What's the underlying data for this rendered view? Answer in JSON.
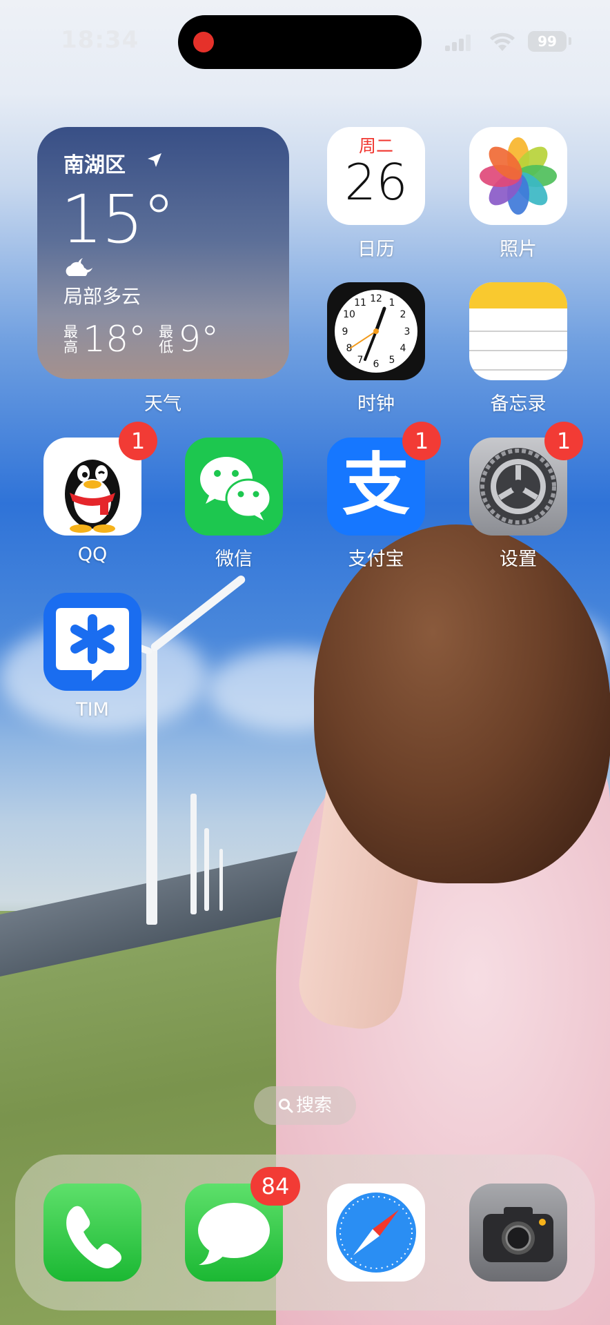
{
  "status_bar": {
    "time": "18:34",
    "battery": "99"
  },
  "weather_widget": {
    "location": "南湖区",
    "temperature": "15°",
    "condition": "局部多云",
    "high_label": "最高",
    "high_value": "18°",
    "low_label": "最低",
    "low_value": "9°",
    "app_label": "天气"
  },
  "apps": {
    "calendar": {
      "label": "日历",
      "weekday": "周二",
      "day": "26"
    },
    "photos": {
      "label": "照片"
    },
    "clock": {
      "label": "时钟"
    },
    "notes": {
      "label": "备忘录"
    },
    "qq": {
      "label": "QQ",
      "badge": "1"
    },
    "wechat": {
      "label": "微信"
    },
    "alipay": {
      "label": "支付宝",
      "badge": "1",
      "glyph": "支"
    },
    "settings": {
      "label": "设置",
      "badge": "1"
    },
    "tim": {
      "label": "TIM"
    }
  },
  "search_pill": {
    "label": "搜索"
  },
  "dock": {
    "phone": {
      "icon": "phone-icon"
    },
    "messages": {
      "icon": "messages-icon",
      "badge": "84"
    },
    "safari": {
      "icon": "safari-icon"
    },
    "camera": {
      "icon": "camera-icon"
    }
  },
  "colors": {
    "badge": "#f23b35",
    "calendar_weekday": "#f0352e",
    "wechat": "#1dc74f",
    "alipay": "#1677ff"
  }
}
